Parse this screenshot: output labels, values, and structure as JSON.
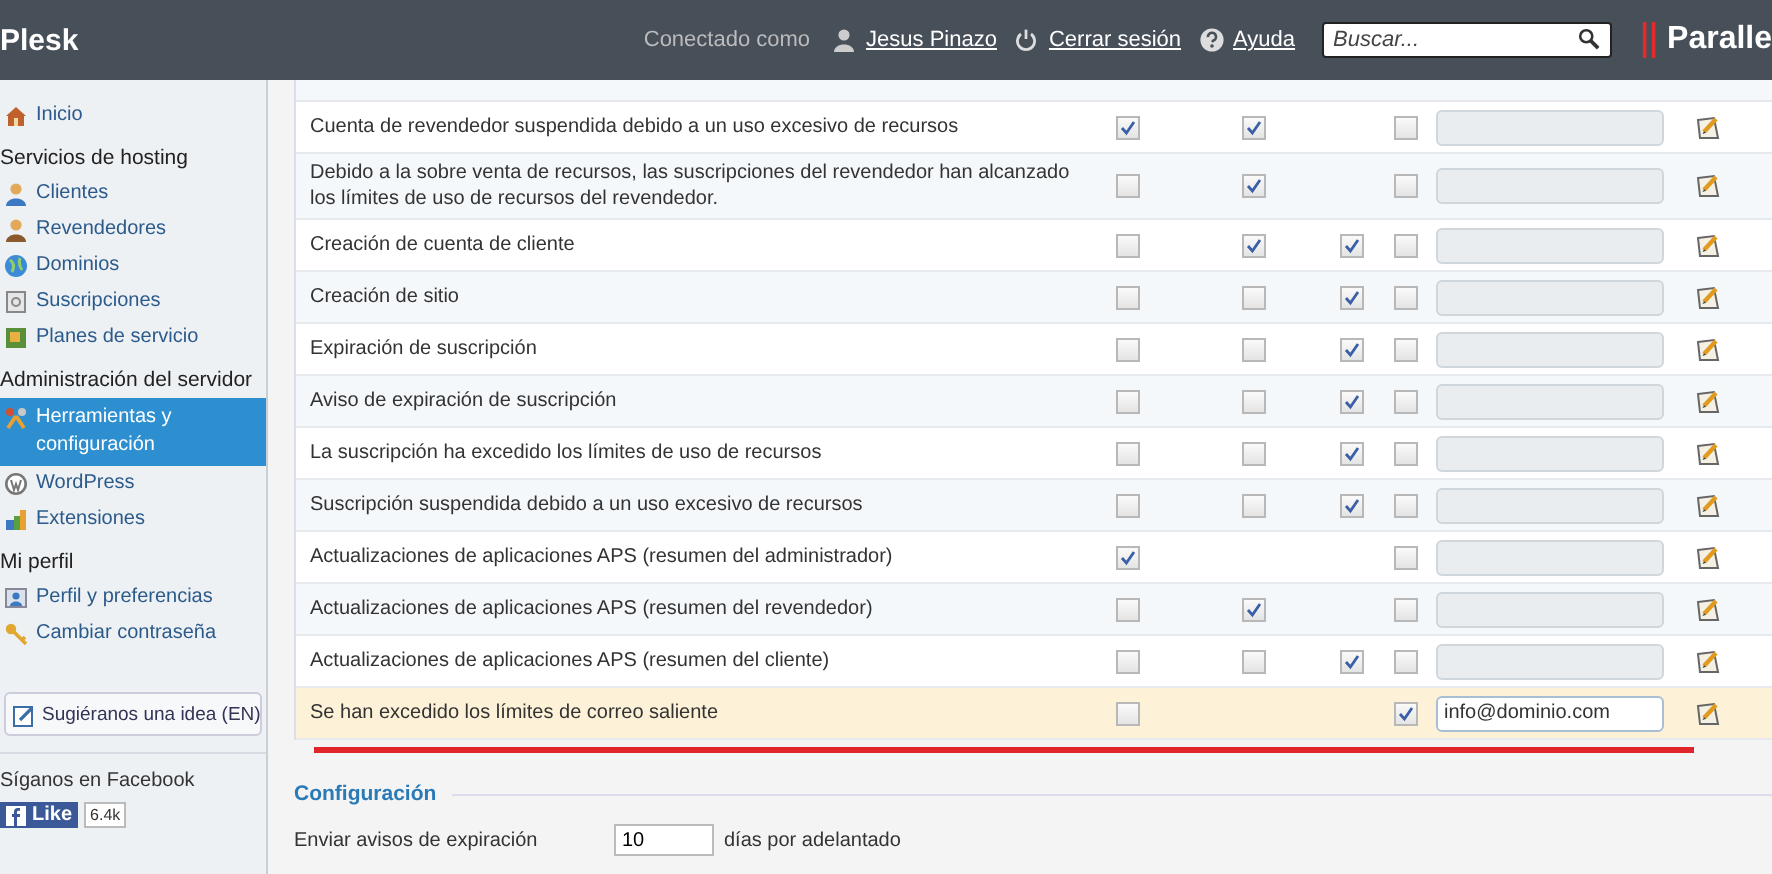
{
  "header": {
    "logo": "Plesk",
    "connected_label": "Conectado como",
    "user": "Jesus Pinazo",
    "logout": "Cerrar sesión",
    "help": "Ayuda",
    "search": {
      "placeholder": "Buscar..."
    },
    "brand": "Paralle"
  },
  "sidebar": {
    "items": [
      {
        "kind": "link",
        "label": "Inicio",
        "selected": false
      },
      {
        "kind": "section",
        "label": "Servicios de hosting"
      },
      {
        "kind": "link",
        "label": "Clientes",
        "selected": false
      },
      {
        "kind": "link",
        "label": "Revendedores",
        "selected": false
      },
      {
        "kind": "link",
        "label": "Dominios",
        "selected": false
      },
      {
        "kind": "link",
        "label": "Suscripciones",
        "selected": false
      },
      {
        "kind": "link",
        "label": "Planes de servicio",
        "selected": false
      },
      {
        "kind": "section",
        "label": "Administración del servidor"
      },
      {
        "kind": "link",
        "label": "Herramientas y configuración",
        "selected": true
      },
      {
        "kind": "link",
        "label": "WordPress",
        "selected": false
      },
      {
        "kind": "link",
        "label": "Extensiones",
        "selected": false
      },
      {
        "kind": "section",
        "label": "Mi perfil"
      },
      {
        "kind": "link",
        "label": "Perfil y preferencias",
        "selected": false
      },
      {
        "kind": "link",
        "label": "Cambiar contraseña",
        "selected": false
      }
    ],
    "suggest_button": "Sugiéranos una idea (EN)",
    "facebook_label": "Síganos en Facebook",
    "like_button": "Like",
    "like_count": "6.4k"
  },
  "table": {
    "rows": [
      {
        "text": "Cuenta de revendedor suspendida debido a un uso excesivo de recursos",
        "highlighted": false,
        "cells": [
          {
            "kind": "checkbox",
            "checked": true
          },
          {
            "kind": "checkbox",
            "checked": true
          },
          {
            "kind": "blank"
          },
          {
            "kind": "checkbox",
            "checked": false
          }
        ]
      },
      {
        "text": "Debido a la sobre venta de recursos, las suscripciones del revendedor han alcanzado los límites de uso de recursos del revendedor.",
        "highlighted": false,
        "cells": [
          {
            "kind": "checkbox",
            "checked": false
          },
          {
            "kind": "checkbox",
            "checked": true
          },
          {
            "kind": "blank"
          },
          {
            "kind": "checkbox",
            "checked": false
          }
        ]
      },
      {
        "text": "Creación de cuenta de cliente",
        "highlighted": false,
        "cells": [
          {
            "kind": "checkbox",
            "checked": false
          },
          {
            "kind": "checkbox",
            "checked": true
          },
          {
            "kind": "checkbox",
            "checked": true
          },
          {
            "kind": "checkbox",
            "checked": false
          }
        ]
      },
      {
        "text": "Creación de sitio",
        "highlighted": false,
        "cells": [
          {
            "kind": "checkbox",
            "checked": false
          },
          {
            "kind": "checkbox",
            "checked": false
          },
          {
            "kind": "checkbox",
            "checked": true
          },
          {
            "kind": "checkbox",
            "checked": false
          }
        ]
      },
      {
        "text": "Expiración de suscripción",
        "highlighted": false,
        "cells": [
          {
            "kind": "checkbox",
            "checked": false
          },
          {
            "kind": "checkbox",
            "checked": false
          },
          {
            "kind": "checkbox",
            "checked": true
          },
          {
            "kind": "checkbox",
            "checked": false
          }
        ]
      },
      {
        "text": "Aviso de expiración de suscripción",
        "highlighted": false,
        "cells": [
          {
            "kind": "checkbox",
            "checked": false
          },
          {
            "kind": "checkbox",
            "checked": false
          },
          {
            "kind": "checkbox",
            "checked": true
          },
          {
            "kind": "checkbox",
            "checked": false
          }
        ]
      },
      {
        "text": "La suscripción ha excedido los límites de uso de recursos",
        "highlighted": false,
        "cells": [
          {
            "kind": "checkbox",
            "checked": false
          },
          {
            "kind": "checkbox",
            "checked": false
          },
          {
            "kind": "checkbox",
            "checked": true
          },
          {
            "kind": "checkbox",
            "checked": false
          }
        ]
      },
      {
        "text": "Suscripción suspendida debido a un uso excesivo de recursos",
        "highlighted": false,
        "cells": [
          {
            "kind": "checkbox",
            "checked": false
          },
          {
            "kind": "checkbox",
            "checked": false
          },
          {
            "kind": "checkbox",
            "checked": true
          },
          {
            "kind": "checkbox",
            "checked": false
          }
        ]
      },
      {
        "text": "Actualizaciones de aplicaciones APS (resumen del administrador)",
        "highlighted": false,
        "cells": [
          {
            "kind": "checkbox",
            "checked": true
          },
          {
            "kind": "blank"
          },
          {
            "kind": "blank"
          },
          {
            "kind": "checkbox",
            "checked": false
          }
        ]
      },
      {
        "text": "Actualizaciones de aplicaciones APS (resumen del revendedor)",
        "highlighted": false,
        "cells": [
          {
            "kind": "checkbox",
            "checked": false
          },
          {
            "kind": "checkbox",
            "checked": true
          },
          {
            "kind": "blank"
          },
          {
            "kind": "checkbox",
            "checked": false
          }
        ]
      },
      {
        "text": "Actualizaciones de aplicaciones APS (resumen del cliente)",
        "highlighted": false,
        "cells": [
          {
            "kind": "checkbox",
            "checked": false
          },
          {
            "kind": "checkbox",
            "checked": false
          },
          {
            "kind": "checkbox",
            "checked": true
          },
          {
            "kind": "checkbox",
            "checked": false
          }
        ]
      },
      {
        "text": "Se han excedido los límites de correo saliente",
        "highlighted": true,
        "email": "info@dominio.com",
        "cells": [
          {
            "kind": "checkbox",
            "checked": false
          },
          {
            "kind": "blank"
          },
          {
            "kind": "blank"
          },
          {
            "kind": "checkbox",
            "checked": true
          }
        ]
      }
    ]
  },
  "settings": {
    "title": "Configuración",
    "label": "Enviar avisos de expiración",
    "value": "10",
    "suffix": "días por adelantado"
  }
}
